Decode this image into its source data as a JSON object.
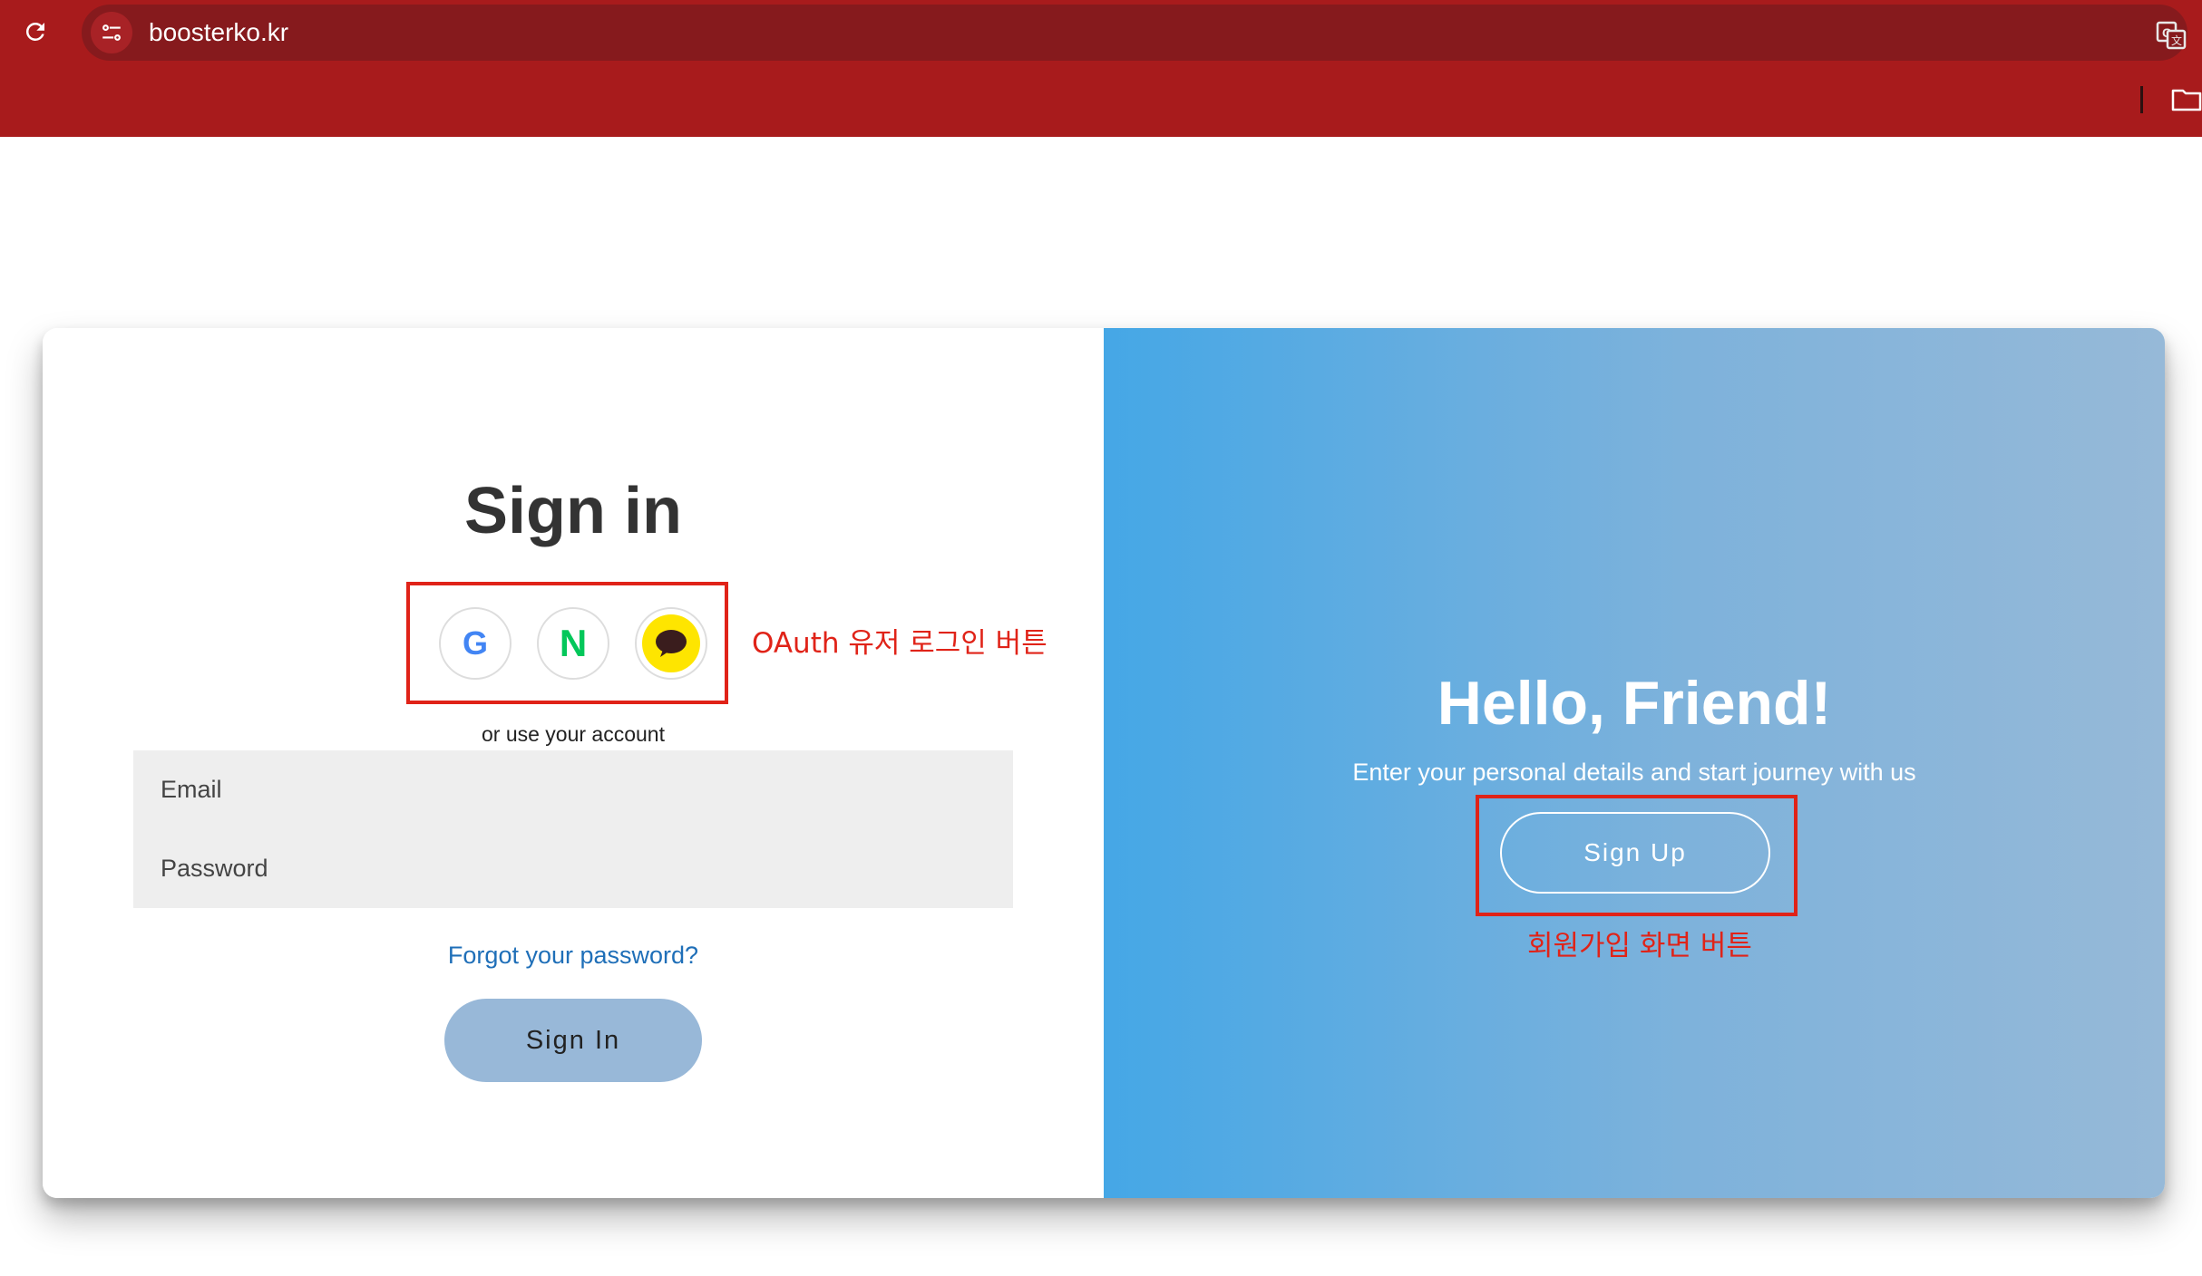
{
  "browser": {
    "url": "boosterko.kr",
    "theme_color": "#a81b1c"
  },
  "signin": {
    "title": "Sign in",
    "social": [
      {
        "name": "google",
        "glyph": "G",
        "icon": "google-icon"
      },
      {
        "name": "naver",
        "glyph": "N",
        "icon": "naver-icon"
      },
      {
        "name": "kakao",
        "icon": "kakaotalk-icon"
      }
    ],
    "divider_text": "or use your account",
    "email_placeholder": "Email",
    "password_placeholder": "Password",
    "forgot_link": "Forgot your password?",
    "button_label": "Sign In"
  },
  "overlay": {
    "title": "Hello, Friend!",
    "subtitle": "Enter your personal details and start journey with us",
    "button_label": "Sign Up"
  },
  "annotations": {
    "oauth_label": "OAuth 유저 로그인 버튼",
    "signup_label": "회원가입 화면 버튼",
    "color": "#e02318"
  }
}
